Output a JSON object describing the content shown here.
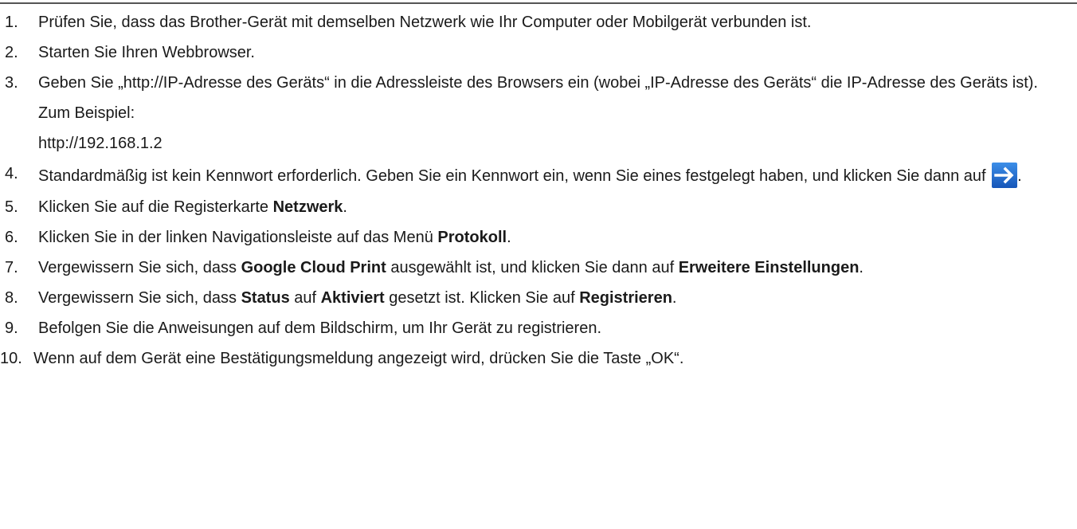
{
  "colors": {
    "rule": "#555555",
    "text": "#1a1a1a",
    "arrow_bg": "#1e6fd0",
    "arrow_fg": "#ffffff"
  },
  "steps": [
    {
      "num": "1.",
      "text": "Prüfen Sie, dass das Brother-Gerät mit demselben Netzwerk wie Ihr Computer oder Mobilgerät verbunden ist."
    },
    {
      "num": "2.",
      "text": "Starten Sie Ihren Webbrowser."
    },
    {
      "num": "3.",
      "text": "Geben Sie „http://IP-Adresse des Geräts“ in die Adressleiste des Browsers ein (wobei „IP-Adresse des Geräts“ die IP-Adresse des Geräts ist).",
      "example_label": "Zum Beispiel:",
      "example_value": "http://192.168.1.2"
    },
    {
      "num": "4.",
      "text_a": "Standardmäßig ist kein Kennwort erforderlich. Geben Sie ein Kennwort ein, wenn Sie eines festgelegt haben, und klicken Sie dann auf ",
      "icon": "arrow-right-icon",
      "text_b": "."
    },
    {
      "num": "5.",
      "text_a": "Klicken Sie auf die Registerkarte ",
      "bold_a": "Netzwerk",
      "text_b": "."
    },
    {
      "num": "6.",
      "text_a": "Klicken Sie in der linken Navigationsleiste auf das Menü ",
      "bold_a": "Protokoll",
      "text_b": "."
    },
    {
      "num": "7.",
      "text_a": "Vergewissern Sie sich, dass ",
      "bold_a": "Google Cloud Print",
      "text_b": " ausgewählt ist, und klicken Sie dann auf ",
      "bold_b": "Erweitere Einstellungen",
      "text_c": "."
    },
    {
      "num": "8.",
      "text_a": "Vergewissern Sie sich, dass ",
      "bold_a": "Status",
      "text_b": " auf ",
      "bold_b": "Aktiviert",
      "text_c": " gesetzt ist. Klicken Sie auf ",
      "bold_c": "Registrieren",
      "text_d": "."
    },
    {
      "num": "9.",
      "text": "Befolgen Sie die Anweisungen auf dem Bildschirm, um Ihr Gerät zu registrieren."
    },
    {
      "num": "10.",
      "text": "Wenn auf dem Gerät eine Bestätigungsmeldung angezeigt wird, drücken Sie die Taste „OK“."
    }
  ]
}
